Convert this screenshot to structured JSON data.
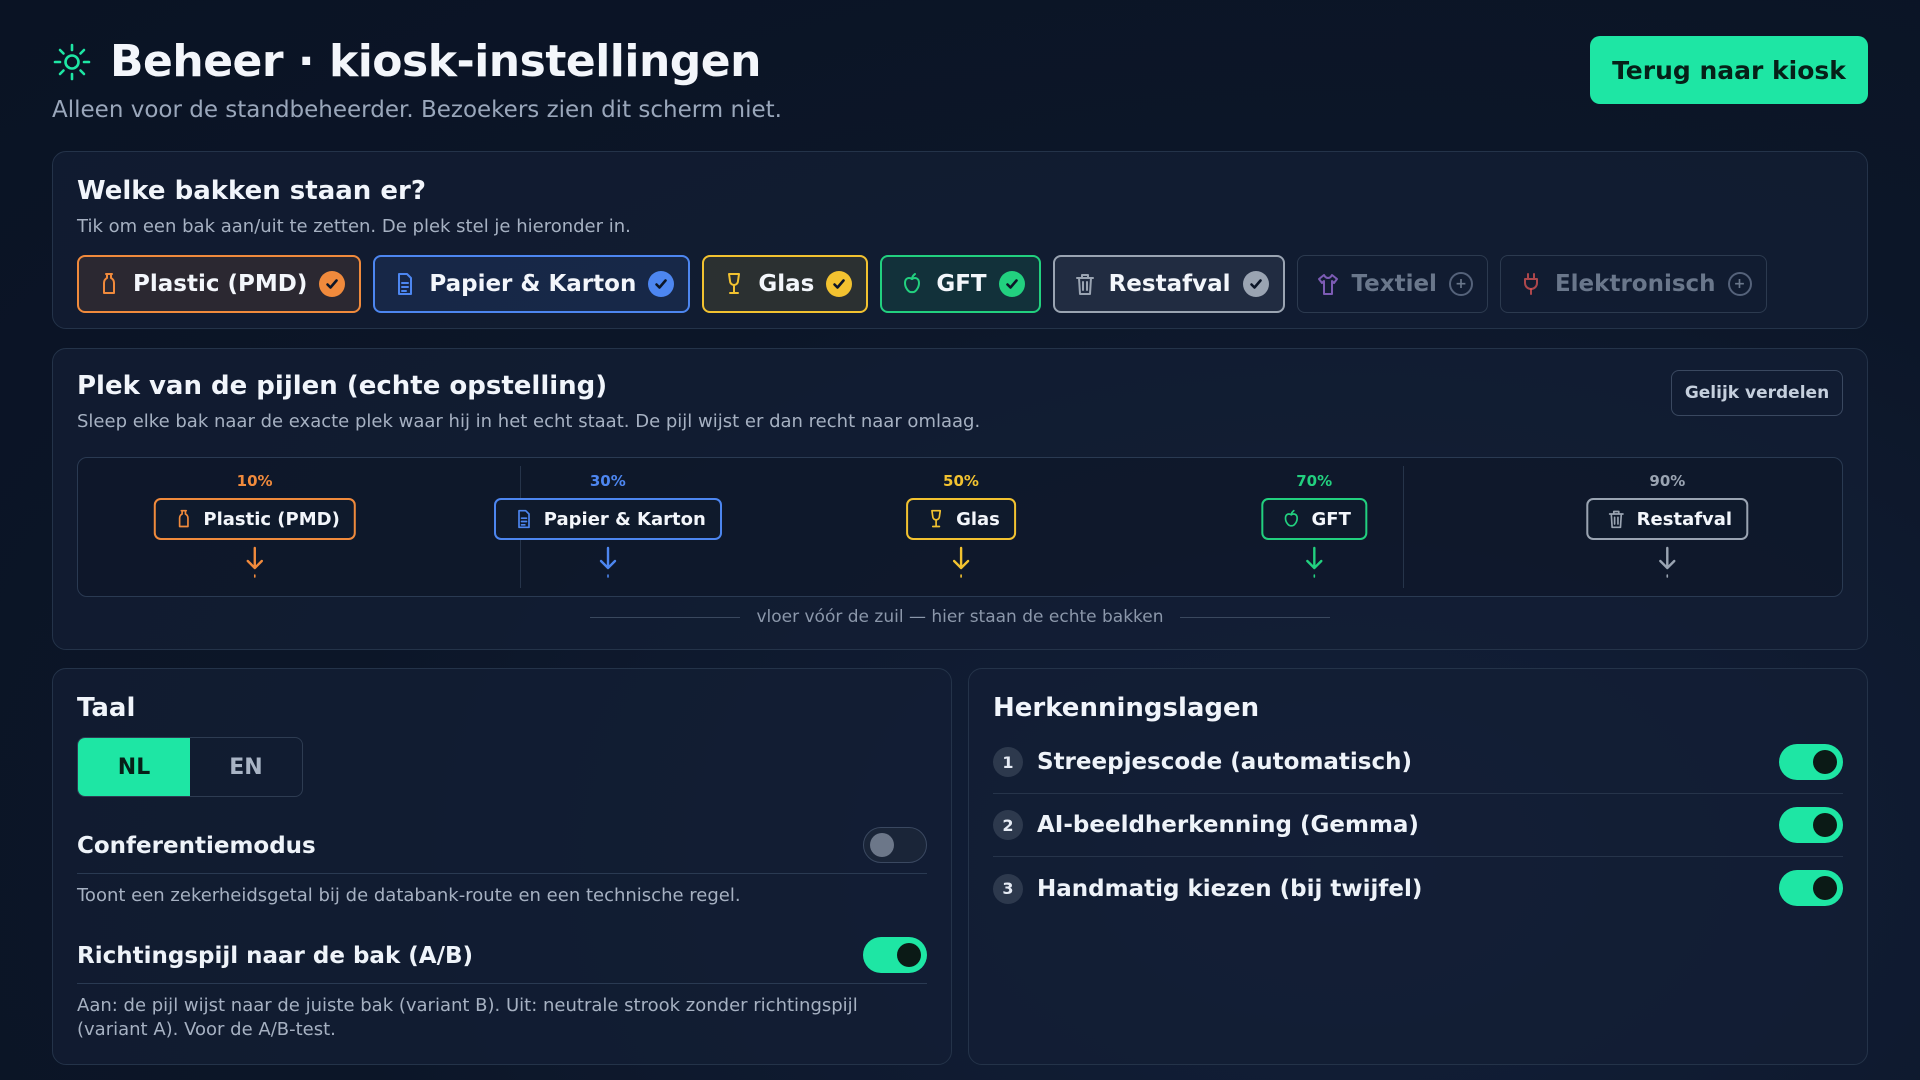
{
  "header": {
    "title": "Beheer · kiosk-instellingen",
    "subtitle": "Alleen voor de standbeheerder. Bezoekers zien dit scherm niet.",
    "back_label": "Terug naar kiosk"
  },
  "bins": {
    "title": "Welke bakken staan er?",
    "hint": "Tik om een bak aan/uit te zetten. De plek stel je hieronder in.",
    "items": [
      {
        "label": "Plastic (PMD)",
        "icon": "bottle-icon",
        "enabled": true,
        "color": "#f08a3c"
      },
      {
        "label": "Papier & Karton",
        "icon": "document-icon",
        "enabled": true,
        "color": "#4d86f0"
      },
      {
        "label": "Glas",
        "icon": "glass-icon",
        "enabled": true,
        "color": "#f2c230"
      },
      {
        "label": "GFT",
        "icon": "apple-icon",
        "enabled": true,
        "color": "#22d07f"
      },
      {
        "label": "Restafval",
        "icon": "trash-icon",
        "enabled": true,
        "color": "#9aa4b2"
      },
      {
        "label": "Textiel",
        "icon": "shirt-icon",
        "enabled": false,
        "color": "#a070e0"
      },
      {
        "label": "Elektronisch",
        "icon": "plug-icon",
        "enabled": false,
        "color": "#e05555"
      }
    ]
  },
  "arrows": {
    "title": "Plek van de pijlen (echte opstelling)",
    "hint": "Sleep elke bak naar de exacte plek waar hij in het echt staat. De pijl wijst er dan recht naar omlaag.",
    "equal_label": "Gelijk verdelen",
    "floor_label": "vloer vóór de zuil — hier staan de echte bakken",
    "markers": [
      {
        "label": "Plastic (PMD)",
        "position_pct": 10,
        "pct_label": "10%",
        "icon": "bottle-icon",
        "color": "#f08a3c"
      },
      {
        "label": "Papier & Karton",
        "position_pct": 30,
        "pct_label": "30%",
        "icon": "document-icon",
        "color": "#4d86f0"
      },
      {
        "label": "Glas",
        "position_pct": 50,
        "pct_label": "50%",
        "icon": "glass-icon",
        "color": "#f2c230"
      },
      {
        "label": "GFT",
        "position_pct": 70,
        "pct_label": "70%",
        "icon": "apple-icon",
        "color": "#22d07f"
      },
      {
        "label": "Restafval",
        "position_pct": 90,
        "pct_label": "90%",
        "icon": "trash-icon",
        "color": "#9aa4b2"
      }
    ]
  },
  "language": {
    "title": "Taal",
    "options": [
      "NL",
      "EN"
    ],
    "selected": "NL",
    "conference": {
      "title": "Conferentiemodus",
      "desc": "Toont een zekerheidsgetal bij de databank-route en een technische regel.",
      "enabled": false
    },
    "direction_arrow": {
      "title": "Richtingspijl naar de bak (A/B)",
      "desc": "Aan: de pijl wijst naar de juiste bak (variant B). Uit: neutrale strook zonder richtingspijl (variant A). Voor de A/B-test.",
      "enabled": true
    }
  },
  "layers": {
    "title": "Herkenningslagen",
    "items": [
      {
        "num": "1",
        "label": "Streepjescode (automatisch)",
        "enabled": true
      },
      {
        "num": "2",
        "label": "AI-beeldherkenning (Gemma)",
        "enabled": true
      },
      {
        "num": "3",
        "label": "Handmatig kiezen (bij twijfel)",
        "enabled": true
      }
    ]
  },
  "colors": {
    "accent": "#1ee6a4",
    "background": "#0c1628"
  }
}
